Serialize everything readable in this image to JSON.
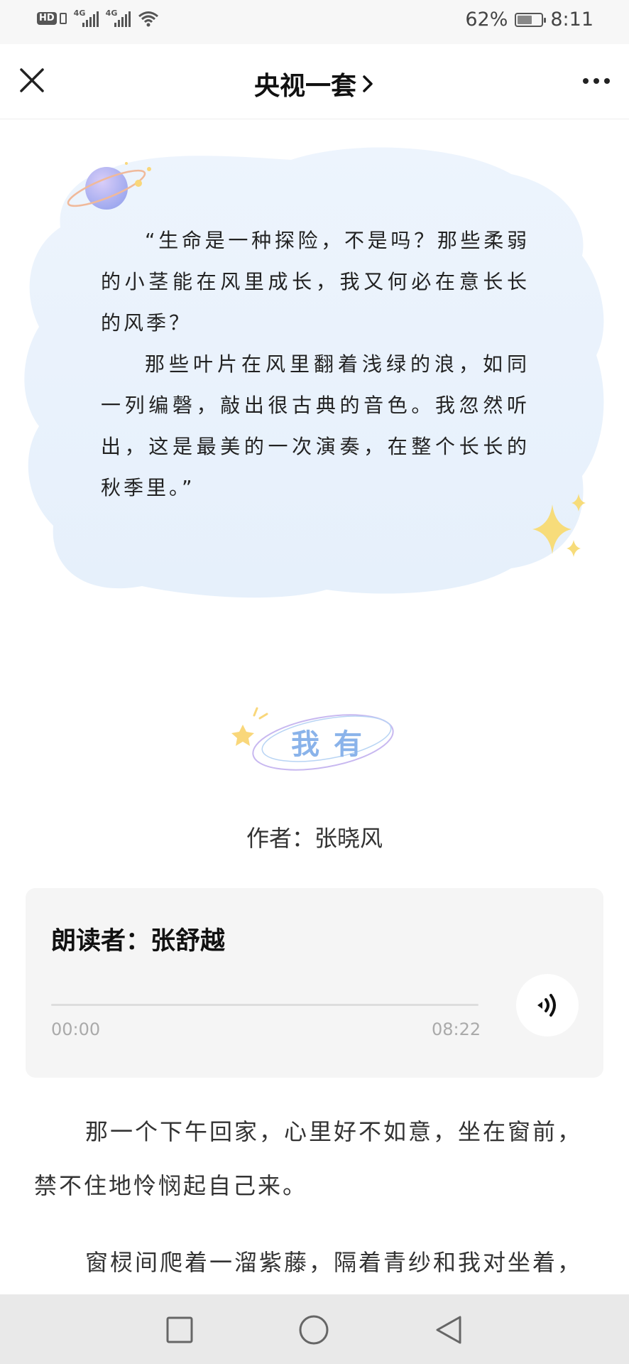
{
  "status_bar": {
    "hd_label": "HD",
    "network_1": "4G",
    "network_2": "4G",
    "battery_percent": "62%",
    "battery_level": 0.62,
    "time": "8:11"
  },
  "nav": {
    "title": "央视一套",
    "chevron": "›"
  },
  "quote": {
    "paragraphs": [
      "“生命是一种探险，不是吗？那些柔弱的小茎能在风里成长，我又何必在意长长的风季？",
      "那些叶片在风里翻着浅绿的浪，如同一列编磬，敲出很古典的音色。我忽然听出，这是最美的一次演奏，在整个长长的秋季里。”"
    ]
  },
  "article_title": "我有",
  "author": "作者：张晓风",
  "audio": {
    "reader": "朗读者：张舒越",
    "time_current": "00:00",
    "time_total": "08:22",
    "progress": 0
  },
  "article": {
    "paragraphs": [
      "那一个下午回家，心里好不如意，坐在窗前，禁不住地怜悯起自己来。",
      "窗棂间爬着一溜紫藤，隔着青纱和我对坐着，"
    ]
  },
  "icons": {
    "close": "close-icon",
    "more": "more-icon",
    "play": "audio-play-icon",
    "recent": "square-icon",
    "home": "circle-icon",
    "back": "triangle-back-icon"
  }
}
